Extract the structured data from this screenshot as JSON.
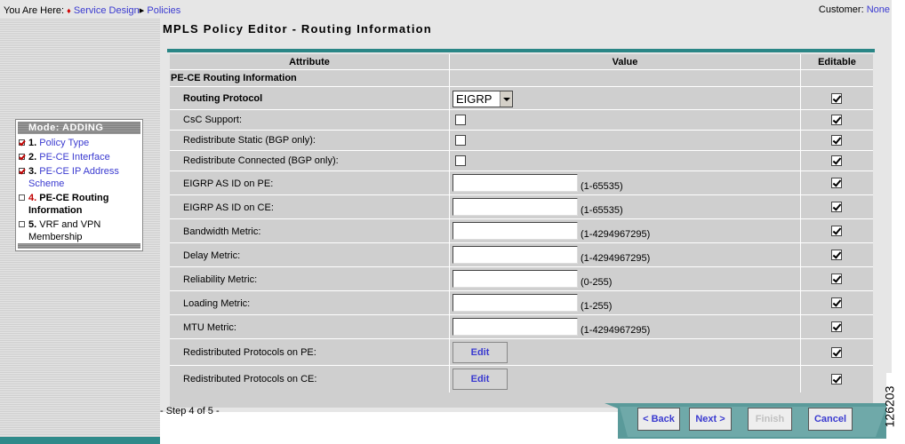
{
  "breadcrumb": {
    "prefix": "You Are Here:",
    "marker": "♦",
    "items": [
      "Service Design",
      "Policies"
    ],
    "separator": "▸"
  },
  "customer": {
    "label": "Customer:",
    "value": "None"
  },
  "page_title": "MPLS Policy Editor - Routing Information",
  "steps": {
    "mode": "Mode: ADDING",
    "items": [
      {
        "num": "1.",
        "label": "Policy Type",
        "checked": true,
        "current": false
      },
      {
        "num": "2.",
        "label": "PE-CE Interface",
        "checked": true,
        "current": false
      },
      {
        "num": "3.",
        "label": "PE-CE IP Address Scheme",
        "checked": true,
        "current": false
      },
      {
        "num": "4.",
        "label": "PE-CE Routing Information",
        "checked": false,
        "current": true
      },
      {
        "num": "5.",
        "label": "VRF and VPN Membership",
        "checked": false,
        "current": false
      }
    ]
  },
  "table": {
    "headers": {
      "attribute": "Attribute",
      "value": "Value",
      "editable": "Editable"
    },
    "section": "PE-CE Routing Information",
    "rows": [
      {
        "label": "Routing Protocol",
        "type": "select",
        "value": "EIGRP",
        "editable": true
      },
      {
        "label": "CsC Support:",
        "type": "checkbox",
        "checked": false,
        "editable": true
      },
      {
        "label": "Redistribute Static (BGP only):",
        "type": "checkbox",
        "checked": false,
        "editable": true
      },
      {
        "label": "Redistribute Connected (BGP only):",
        "type": "checkbox",
        "checked": false,
        "editable": true
      },
      {
        "label": "EIGRP AS ID on PE:",
        "type": "text",
        "value": "",
        "range": "(1-65535)",
        "editable": true
      },
      {
        "label": "EIGRP AS ID on CE:",
        "type": "text",
        "value": "",
        "range": "(1-65535)",
        "editable": true
      },
      {
        "label": "Bandwidth Metric:",
        "type": "text",
        "value": "",
        "range": "(1-4294967295)",
        "editable": true
      },
      {
        "label": "Delay Metric:",
        "type": "text",
        "value": "",
        "range": "(1-4294967295)",
        "editable": true
      },
      {
        "label": "Reliability Metric:",
        "type": "text",
        "value": "",
        "range": "(0-255)",
        "editable": true
      },
      {
        "label": "Loading Metric:",
        "type": "text",
        "value": "",
        "range": "(1-255)",
        "editable": true
      },
      {
        "label": "MTU Metric:",
        "type": "text",
        "value": "",
        "range": "(1-4294967295)",
        "editable": true
      },
      {
        "label": "Redistributed Protocols on PE:",
        "type": "button",
        "value": "Edit",
        "editable": true
      },
      {
        "label": "Redistributed Protocols on CE:",
        "type": "button",
        "value": "Edit",
        "editable": true
      }
    ]
  },
  "footer": {
    "step_text": "- Step 4 of 5 -",
    "buttons": {
      "back": "< Back",
      "next": "Next >",
      "finish": "Finish",
      "cancel": "Cancel"
    }
  },
  "figure_id": "126203"
}
